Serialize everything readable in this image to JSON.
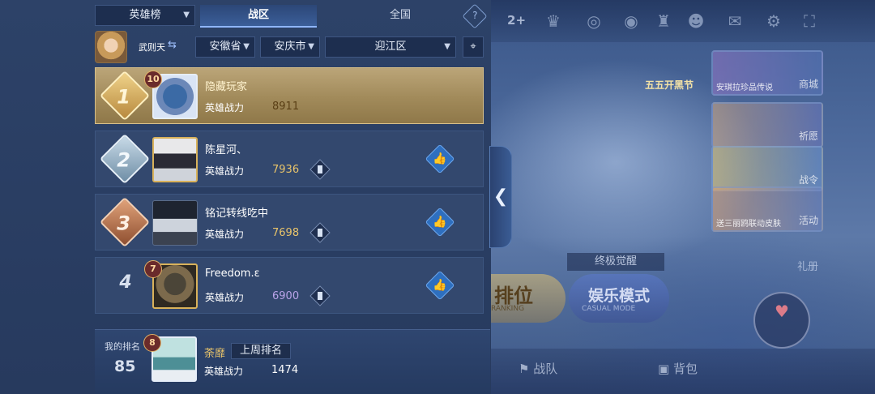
{
  "header": {
    "board_dropdown": "英雄榜",
    "tabs": [
      {
        "label": "战区",
        "active": true
      },
      {
        "label": "全国",
        "active": false
      }
    ],
    "help": "?"
  },
  "filters": {
    "player_name": "武则天",
    "province": "安徽省",
    "city": "安庆市",
    "district": "迎江区"
  },
  "rankings": [
    {
      "rank": "1",
      "level": "10",
      "name": "隐藏玩家",
      "power_label": "英雄战力",
      "power": "8911",
      "power_color": "#5a3f15"
    },
    {
      "rank": "2",
      "level": "",
      "name": "陈星河、",
      "power_label": "英雄战力",
      "power": "7936",
      "power_color": "#e9c46a"
    },
    {
      "rank": "3",
      "level": "",
      "name": "铭记转线吃中",
      "power_label": "英雄战力",
      "power": "7698",
      "power_color": "#e9c46a"
    },
    {
      "rank": "4",
      "level": "7",
      "name": "Freedom.ε",
      "power_label": "英雄战力",
      "power": "6900",
      "power_color": "#b9a3e8"
    }
  ],
  "my_rank": {
    "label": "我的排名",
    "rank": "85",
    "level": "8",
    "name": "荼靡",
    "tag": "上周排名",
    "power_label": "英雄战力",
    "power": "1474"
  },
  "lobby": {
    "count": "2",
    "event_cards": [
      {
        "caption": "安琪拉珍品传说",
        "side": "商城"
      },
      {
        "caption": "",
        "side": "祈愿"
      },
      {
        "caption": "",
        "side": "战令"
      },
      {
        "caption": "送三丽鸥联动皮肤",
        "side": "活动"
      }
    ],
    "gift_label": "礼册",
    "festival_label": "五五开黑节",
    "awaken_label": "终极觉醒",
    "ranked_label": "排位",
    "ranked_sub": "RANKING",
    "casual_label": "娱乐模式",
    "casual_sub": "CASUAL MODE",
    "team_label": "战队",
    "bag_label": "背包"
  },
  "colors": {
    "panel_bg": "#2d4268",
    "top_row_gold": "#bba578",
    "accent_blue": "#8fb6ff",
    "power_gold": "#e9c46a"
  }
}
